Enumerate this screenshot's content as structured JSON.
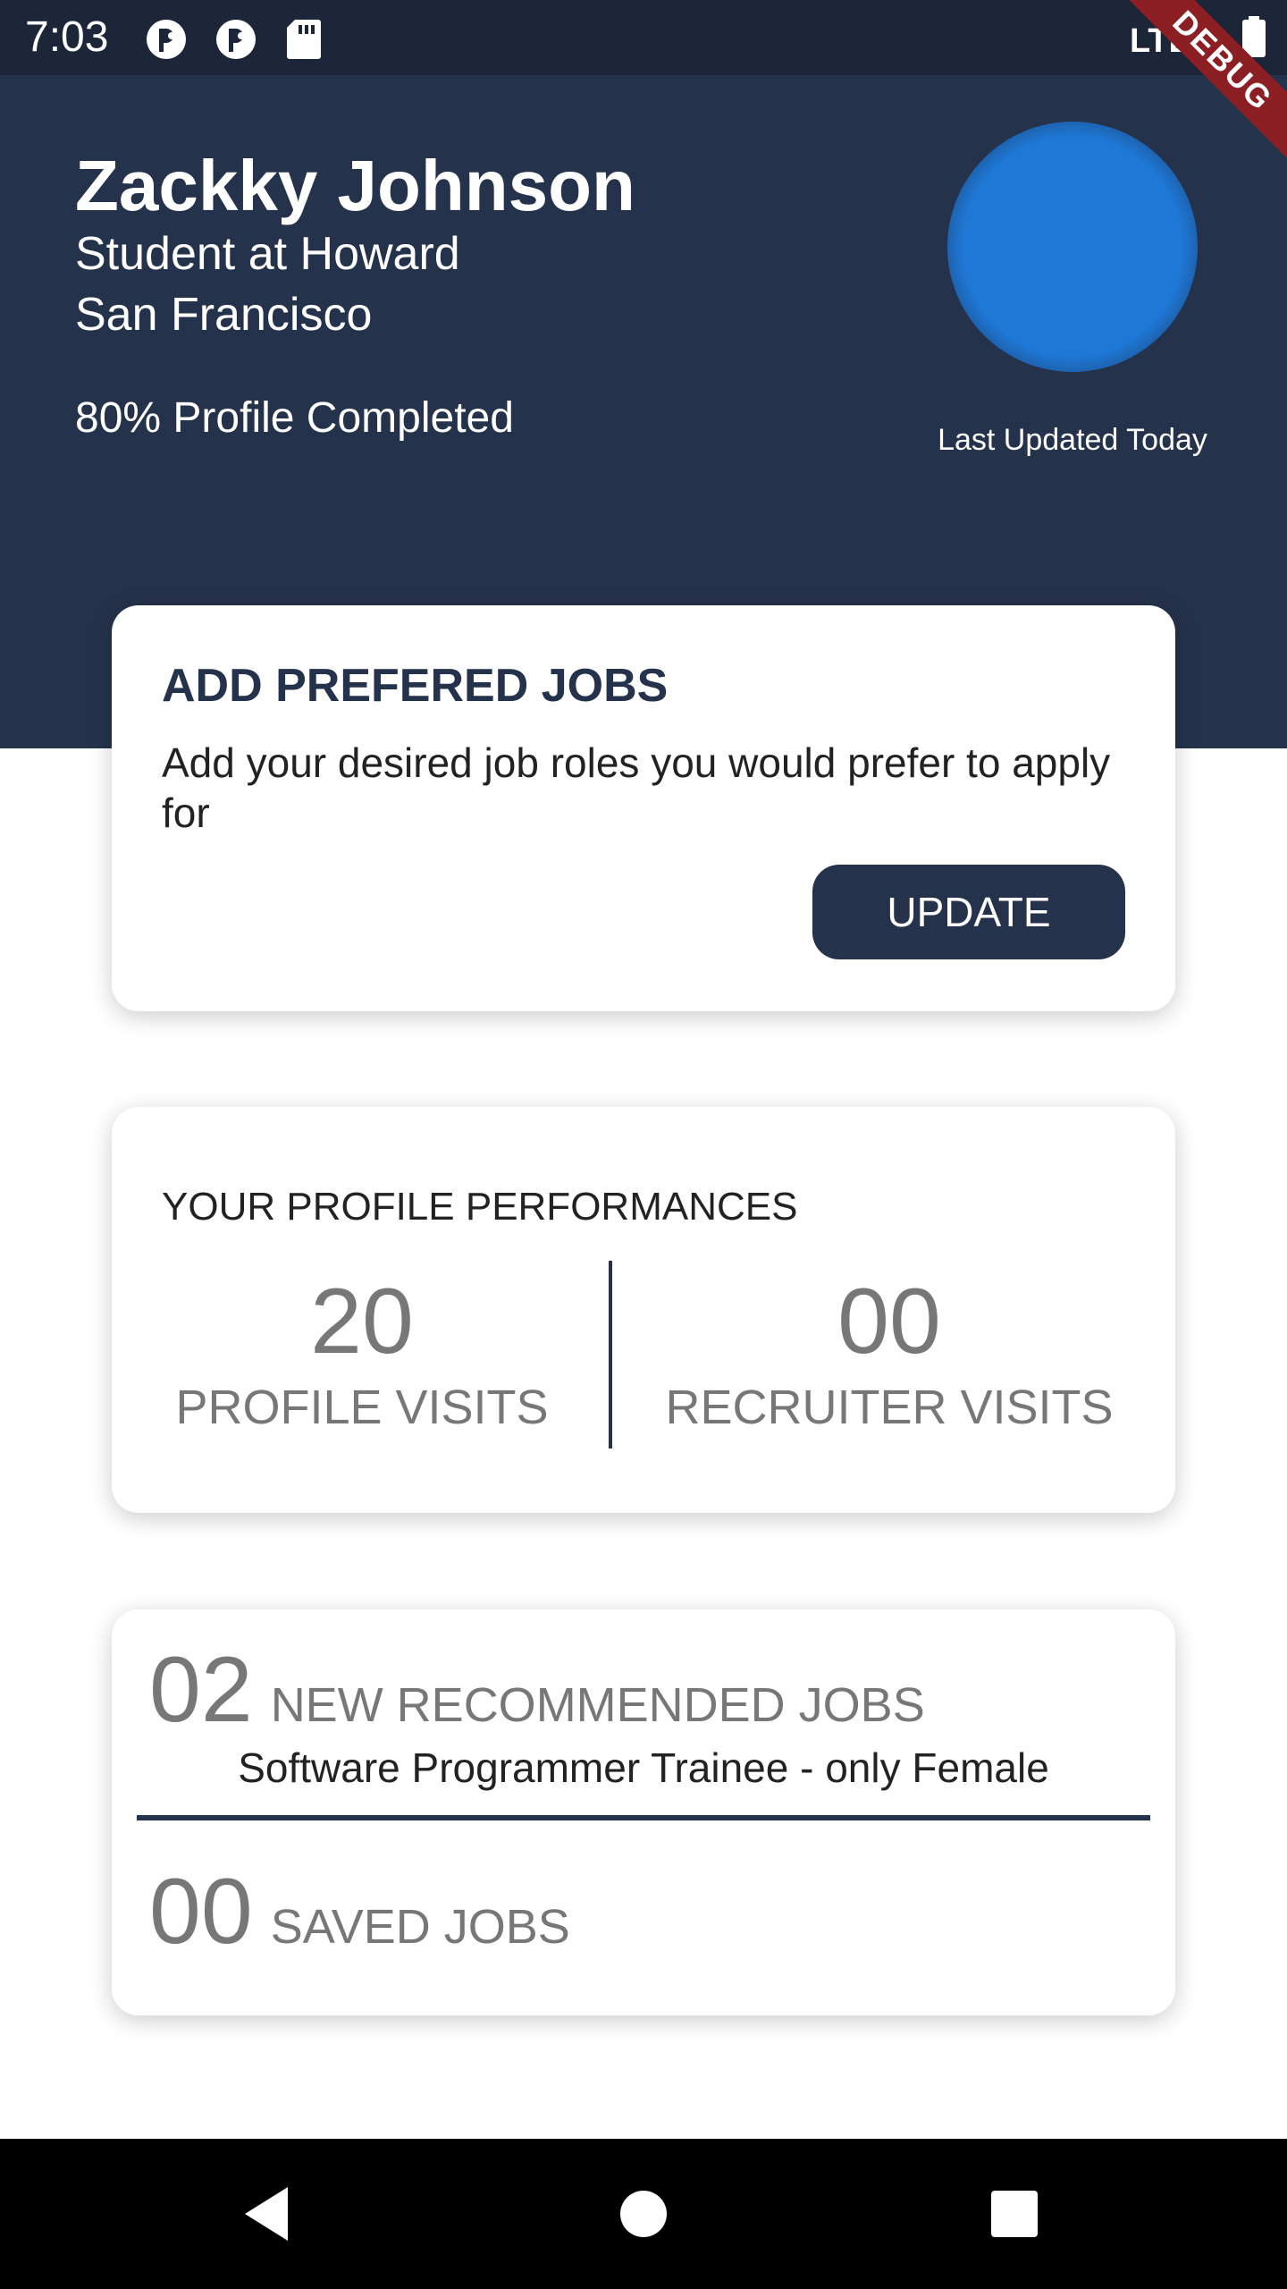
{
  "status_bar": {
    "time": "7:03",
    "icons": [
      "notification-icon",
      "notification-icon",
      "sd-card-icon",
      "lte-signal-icon",
      "battery-icon"
    ]
  },
  "debug_banner": "DEBUG",
  "profile": {
    "name": "Zackky Johnson",
    "title": "Student at Howard",
    "location": "San Francisco",
    "completion_text": "80% Profile Completed",
    "completion_percent": 80,
    "last_updated": "Last Updated Today"
  },
  "preferred_jobs": {
    "title": "ADD PREFERED JOBS",
    "description": "Add your desired job roles you would prefer to apply for",
    "button_label": "UPDATE"
  },
  "performance": {
    "title": "YOUR PROFILE PERFORMANCES",
    "profile_visits": "20",
    "profile_visits_label": "PROFILE VISITS",
    "recruiter_visits": "00",
    "recruiter_visits_label": "RECRUITER VISITS"
  },
  "recommended": {
    "count": "02",
    "label": "NEW RECOMMENDED JOBS",
    "job": "Software Programmer Trainee - only Female"
  },
  "saved": {
    "count": "00",
    "label": "SAVED JOBS"
  },
  "colors": {
    "header_bg": "#25324b",
    "status_bg": "#1c2638",
    "accent": "#1f78d6",
    "button_bg": "#25324b",
    "debug_banner": "#8c1f23"
  }
}
